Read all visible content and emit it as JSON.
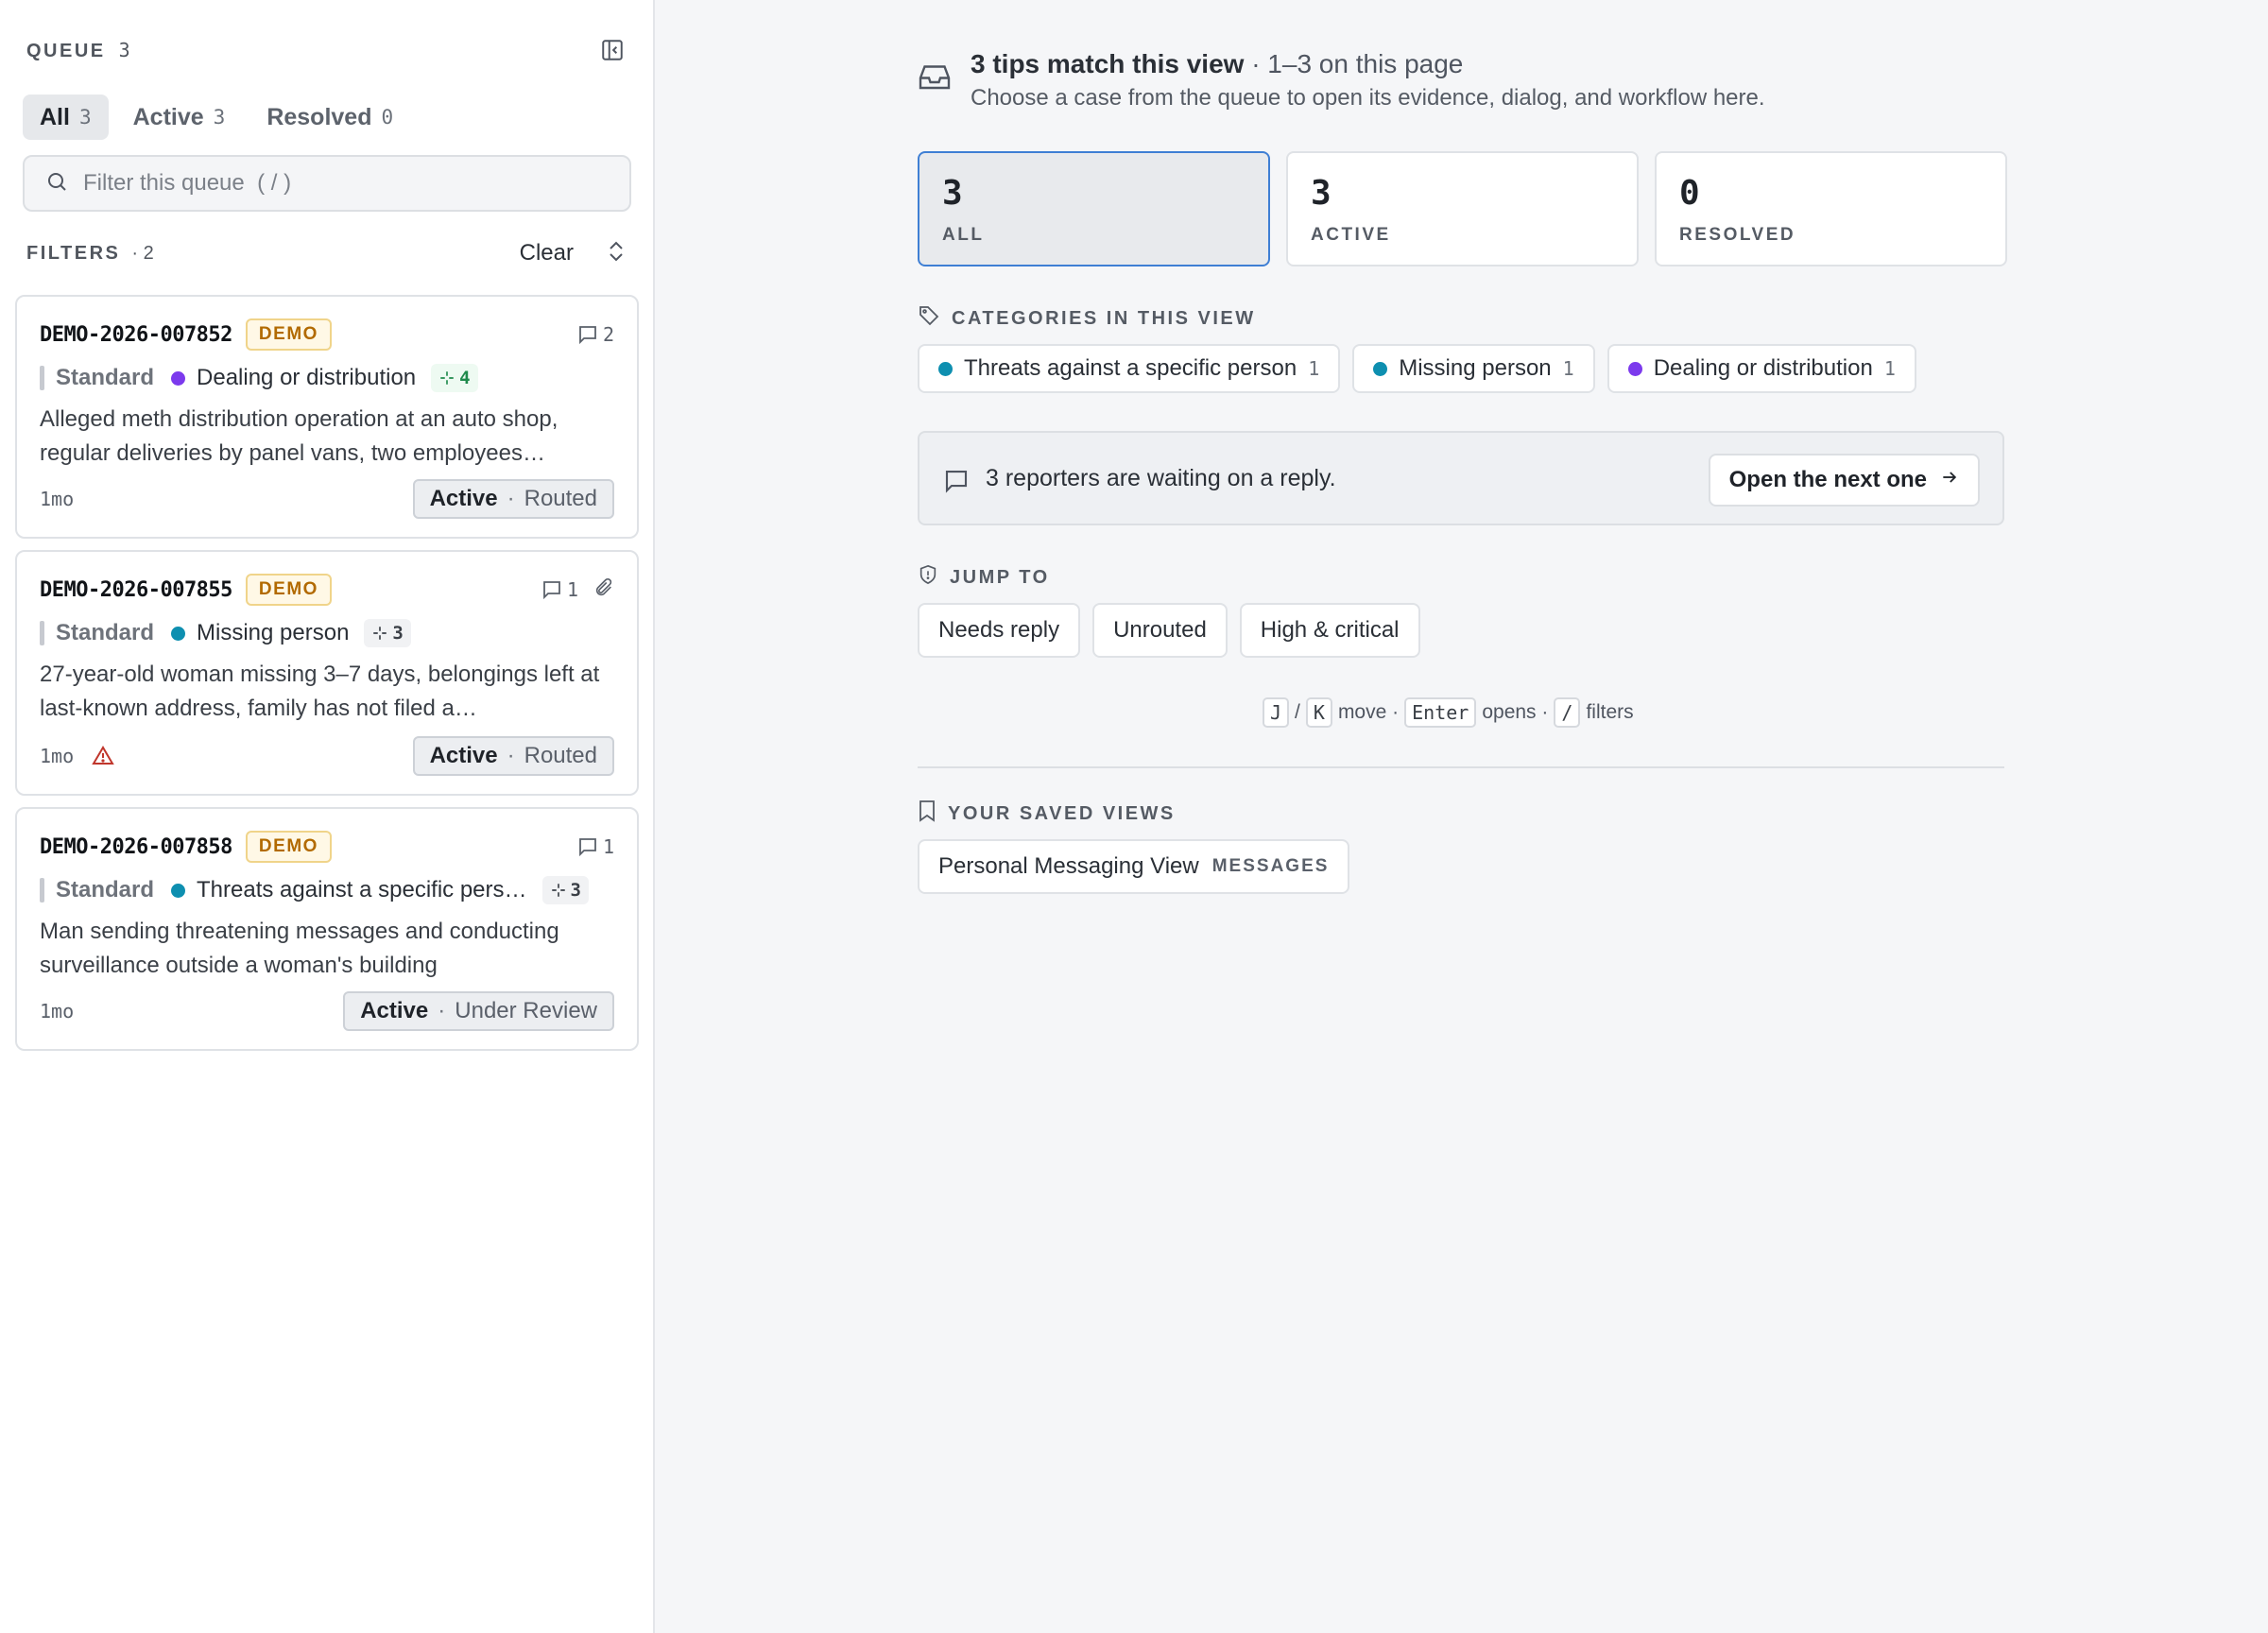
{
  "sidebar": {
    "title": "QUEUE",
    "count": "3",
    "collapse_icon": "sidebar-collapse-icon",
    "tabs": [
      {
        "label": "All",
        "count": "3"
      },
      {
        "label": "Active",
        "count": "3"
      },
      {
        "label": "Resolved",
        "count": "0"
      }
    ],
    "search": {
      "placeholder": "Filter this queue  ( / )",
      "value": ""
    },
    "filters": {
      "label": "FILTERS",
      "count": "· 2",
      "clear_label": "Clear"
    },
    "cards": [
      {
        "id": "DEMO-2026-007852",
        "badge": "DEMO",
        "comments": "2",
        "has_attachment": false,
        "priority": "Standard",
        "category": "Dealing or distribution",
        "category_color": "#7c3aed",
        "tag_count": "4",
        "tag_style": "green",
        "summary": "Alleged meth distribution operation at an auto shop, regular deliveries by panel vans, two employees…",
        "age": "1mo",
        "warning": false,
        "status": "Active",
        "substatus": "Routed"
      },
      {
        "id": "DEMO-2026-007855",
        "badge": "DEMO",
        "comments": "1",
        "has_attachment": true,
        "priority": "Standard",
        "category": "Missing person",
        "category_color": "#0e8fb0",
        "tag_count": "3",
        "tag_style": "gray",
        "summary": "27-year-old woman missing 3–7 days, belongings left at last-known address, family has not filed a…",
        "age": "1mo",
        "warning": true,
        "status": "Active",
        "substatus": "Routed"
      },
      {
        "id": "DEMO-2026-007858",
        "badge": "DEMO",
        "comments": "1",
        "has_attachment": false,
        "priority": "Standard",
        "category": "Threats against a specific pers…",
        "category_color": "#0e8fb0",
        "tag_count": "3",
        "tag_style": "gray",
        "summary": "Man sending threatening messages and conducting surveillance outside a woman's building",
        "age": "1mo",
        "warning": false,
        "status": "Active",
        "substatus": "Under Review"
      }
    ]
  },
  "main": {
    "header": {
      "title_strong": "3 tips match this view",
      "title_light": " · 1–3 on this page",
      "subtitle": "Choose a case from the queue to open its evidence, dialog, and workflow here."
    },
    "stats": [
      {
        "value": "3",
        "label": "ALL"
      },
      {
        "value": "3",
        "label": "ACTIVE"
      },
      {
        "value": "0",
        "label": "RESOLVED"
      }
    ],
    "categories_label": "CATEGORIES IN THIS VIEW",
    "categories": [
      {
        "label": "Threats against a specific person",
        "count": "1",
        "color": "#0e8fb0"
      },
      {
        "label": "Missing person",
        "count": "1",
        "color": "#0e8fb0"
      },
      {
        "label": "Dealing or distribution",
        "count": "1",
        "color": "#7c3aed"
      }
    ],
    "reply_banner": {
      "text": "3 reporters are waiting on a reply.",
      "button": "Open the next one"
    },
    "jump_label": "JUMP TO",
    "jump_buttons": [
      "Needs reply",
      "Unrouted",
      "High & critical"
    ],
    "keyboard_hint": {
      "k1": "J",
      "slash": "/",
      "k2": "K",
      "t1": "move ·",
      "k3": "Enter",
      "t2": "opens ·",
      "k4": "/",
      "t3": "filters"
    },
    "saved_views_label": "YOUR SAVED VIEWS",
    "saved_views": [
      {
        "name": "Personal Messaging View",
        "tag": "MESSAGES"
      }
    ]
  },
  "colors": {
    "accent_blue": "#3f7fd4",
    "demo_badge_text": "#b26a00",
    "warning_red": "#c0362c",
    "tag_green": "#1f8a4c"
  }
}
